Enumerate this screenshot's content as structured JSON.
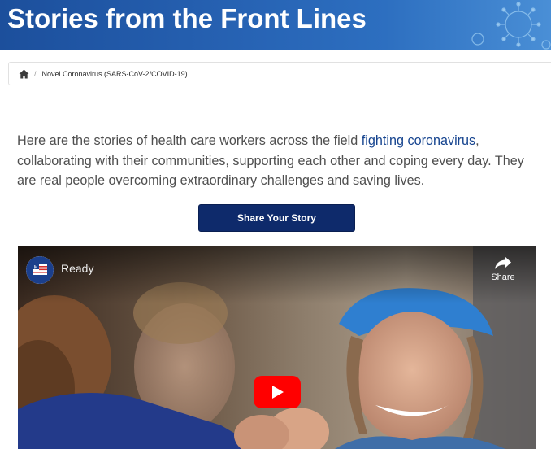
{
  "banner": {
    "title": "Stories from the Front Lines"
  },
  "breadcrumb": {
    "home_icon": "home-icon",
    "separator": "/",
    "current": "Novel Coronavirus (SARS-CoV-2/COVID-19)"
  },
  "intro": {
    "text_before": "Here are the stories of health care workers across the field ",
    "link_text": "fighting coronavirus",
    "text_after": ", collaborating with their communities, supporting each other and coping every day. They are real people overcoming extraordinary challenges and saving lives."
  },
  "share_story_button": "Share Your Story",
  "video": {
    "title": "Ready",
    "share_label": "Share",
    "channel_logo": "hospital-flag-logo",
    "play_icon": "youtube-play-icon",
    "share_icon": "share-arrow-icon"
  },
  "colors": {
    "banner": "#2763b4",
    "button": "#0e2a6b",
    "link": "#16448f",
    "youtube_red": "#ff0000"
  }
}
